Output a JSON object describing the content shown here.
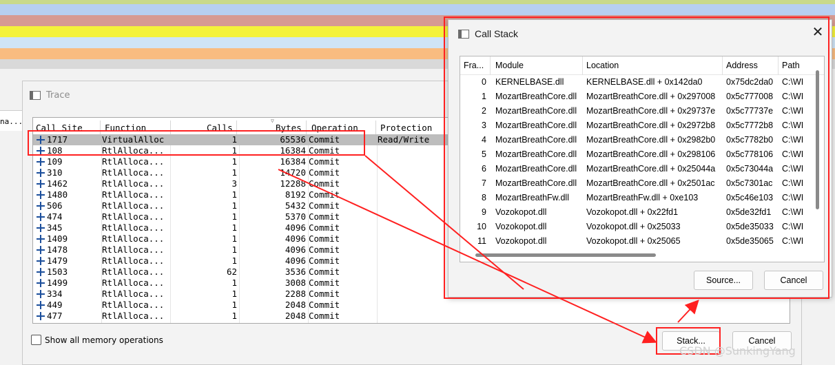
{
  "background_strip_text": "na...",
  "trace": {
    "title": "Trace",
    "columns": [
      "Call Site",
      "Function",
      "Calls",
      "Bytes",
      "Operation",
      "Protection"
    ],
    "rows": [
      {
        "site": "1717",
        "fn": "VirtualAlloc",
        "calls": "1",
        "bytes": "65536",
        "op": "Commit",
        "prot": "Read/Write",
        "selected": true
      },
      {
        "site": "108",
        "fn": "RtlAlloca...",
        "calls": "1",
        "bytes": "16384",
        "op": "Commit",
        "prot": ""
      },
      {
        "site": "109",
        "fn": "RtlAlloca...",
        "calls": "1",
        "bytes": "16384",
        "op": "Commit",
        "prot": ""
      },
      {
        "site": "310",
        "fn": "RtlAlloca...",
        "calls": "1",
        "bytes": "14720",
        "op": "Commit",
        "prot": ""
      },
      {
        "site": "1462",
        "fn": "RtlAlloca...",
        "calls": "3",
        "bytes": "12288",
        "op": "Commit",
        "prot": ""
      },
      {
        "site": "1480",
        "fn": "RtlAlloca...",
        "calls": "1",
        "bytes": "8192",
        "op": "Commit",
        "prot": ""
      },
      {
        "site": "506",
        "fn": "RtlAlloca...",
        "calls": "1",
        "bytes": "5432",
        "op": "Commit",
        "prot": ""
      },
      {
        "site": "474",
        "fn": "RtlAlloca...",
        "calls": "1",
        "bytes": "5370",
        "op": "Commit",
        "prot": ""
      },
      {
        "site": "345",
        "fn": "RtlAlloca...",
        "calls": "1",
        "bytes": "4096",
        "op": "Commit",
        "prot": ""
      },
      {
        "site": "1409",
        "fn": "RtlAlloca...",
        "calls": "1",
        "bytes": "4096",
        "op": "Commit",
        "prot": ""
      },
      {
        "site": "1478",
        "fn": "RtlAlloca...",
        "calls": "1",
        "bytes": "4096",
        "op": "Commit",
        "prot": ""
      },
      {
        "site": "1479",
        "fn": "RtlAlloca...",
        "calls": "1",
        "bytes": "4096",
        "op": "Commit",
        "prot": ""
      },
      {
        "site": "1503",
        "fn": "RtlAlloca...",
        "calls": "62",
        "bytes": "3536",
        "op": "Commit",
        "prot": ""
      },
      {
        "site": "1499",
        "fn": "RtlAlloca...",
        "calls": "1",
        "bytes": "3008",
        "op": "Commit",
        "prot": ""
      },
      {
        "site": "334",
        "fn": "RtlAlloca...",
        "calls": "1",
        "bytes": "2288",
        "op": "Commit",
        "prot": ""
      },
      {
        "site": "449",
        "fn": "RtlAlloca...",
        "calls": "1",
        "bytes": "2048",
        "op": "Commit",
        "prot": ""
      },
      {
        "site": "477",
        "fn": "RtlAlloca...",
        "calls": "1",
        "bytes": "2048",
        "op": "Commit",
        "prot": ""
      }
    ],
    "show_all_label": "Show all memory operations",
    "stack_button": "Stack...",
    "cancel_button": "Cancel"
  },
  "callstack": {
    "title": "Call Stack",
    "columns": [
      "Fra...",
      "Module",
      "Location",
      "Address",
      "Path"
    ],
    "rows": [
      {
        "frame": "0",
        "module": "KERNELBASE.dll",
        "location": "KERNELBASE.dll + 0x142da0",
        "address": "0x75dc2da0",
        "path": "C:\\WI"
      },
      {
        "frame": "1",
        "module": "MozartBreathCore.dll",
        "location": "MozartBreathCore.dll + 0x297008",
        "address": "0x5c777008",
        "path": "C:\\WI"
      },
      {
        "frame": "2",
        "module": "MozartBreathCore.dll",
        "location": "MozartBreathCore.dll + 0x29737e",
        "address": "0x5c77737e",
        "path": "C:\\WI"
      },
      {
        "frame": "3",
        "module": "MozartBreathCore.dll",
        "location": "MozartBreathCore.dll + 0x2972b8",
        "address": "0x5c7772b8",
        "path": "C:\\WI"
      },
      {
        "frame": "4",
        "module": "MozartBreathCore.dll",
        "location": "MozartBreathCore.dll + 0x2982b0",
        "address": "0x5c7782b0",
        "path": "C:\\WI"
      },
      {
        "frame": "5",
        "module": "MozartBreathCore.dll",
        "location": "MozartBreathCore.dll + 0x298106",
        "address": "0x5c778106",
        "path": "C:\\WI"
      },
      {
        "frame": "6",
        "module": "MozartBreathCore.dll",
        "location": "MozartBreathCore.dll + 0x25044a",
        "address": "0x5c73044a",
        "path": "C:\\WI"
      },
      {
        "frame": "7",
        "module": "MozartBreathCore.dll",
        "location": "MozartBreathCore.dll + 0x2501ac",
        "address": "0x5c7301ac",
        "path": "C:\\WI"
      },
      {
        "frame": "8",
        "module": "MozartBreathFw.dll",
        "location": "MozartBreathFw.dll + 0xe103",
        "address": "0x5c46e103",
        "path": "C:\\WI"
      },
      {
        "frame": "9",
        "module": "Vozokopot.dll",
        "location": "Vozokopot.dll + 0x22fd1",
        "address": "0x5de32fd1",
        "path": "C:\\WI"
      },
      {
        "frame": "10",
        "module": "Vozokopot.dll",
        "location": "Vozokopot.dll + 0x25033",
        "address": "0x5de35033",
        "path": "C:\\WI"
      },
      {
        "frame": "11",
        "module": "Vozokopot.dll",
        "location": "Vozokopot.dll + 0x25065",
        "address": "0x5de35065",
        "path": "C:\\WI"
      }
    ],
    "close_icon": "✕",
    "source_button": "Source...",
    "cancel_button": "Cancel"
  },
  "watermark": "CSDN @SunkingYang",
  "colors": {
    "annotation_red": "#ff2020",
    "selected_row": "#bdbdbd",
    "plus_icon": "#1c4f9c"
  }
}
